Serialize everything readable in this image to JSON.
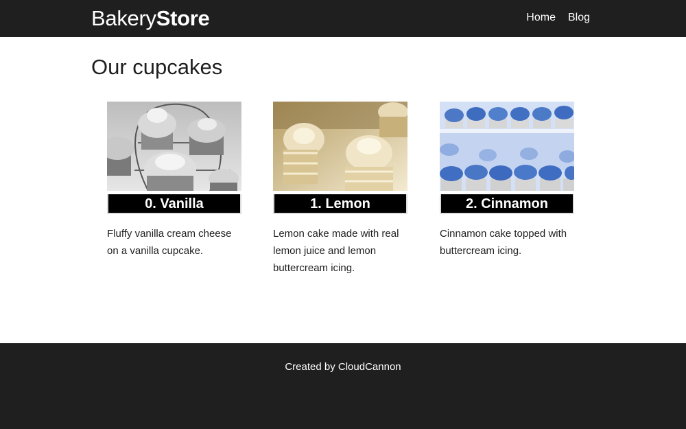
{
  "header": {
    "logo_regular": "Bakery",
    "logo_bold": "Store",
    "nav": [
      {
        "label": "Home"
      },
      {
        "label": "Blog"
      }
    ]
  },
  "main": {
    "title": "Our cupcakes",
    "cupcakes": [
      {
        "name": "0. Vanilla",
        "description": "Fluffy vanilla cream cheese on a vanilla cupcake.",
        "image_tone": "grayscale",
        "image_color": "#8a8a8a"
      },
      {
        "name": "1. Lemon",
        "description": "Lemon cake made with real lemon juice and lemon buttercream icing.",
        "image_tone": "sepia",
        "image_color": "#d8c79e"
      },
      {
        "name": "2. Cinnamon",
        "description": "Cinnamon cake topped with buttercream icing.",
        "image_tone": "blue",
        "image_color": "#5a7fc4"
      }
    ]
  },
  "footer": {
    "text_prefix": "Created by",
    "link": "CloudCannon"
  }
}
